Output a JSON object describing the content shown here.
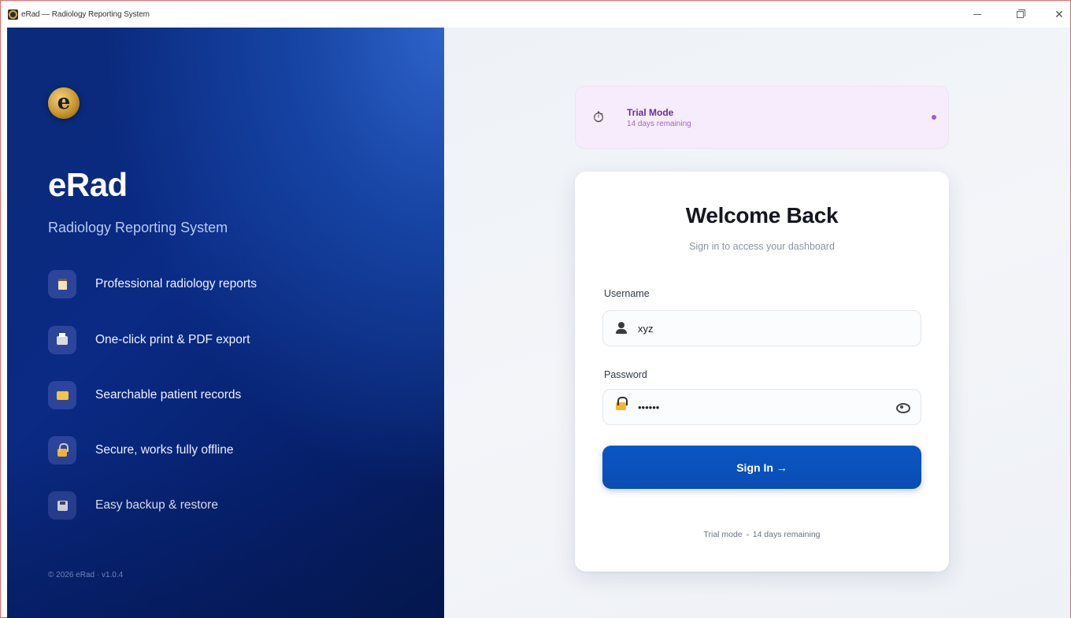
{
  "window": {
    "title": "eRad — Radiology Reporting System"
  },
  "brand": {
    "name": "eRad",
    "tagline": "Radiology Reporting System",
    "logo_icon": "erad-logo-icon"
  },
  "features": [
    {
      "icon": "clipboard-icon",
      "label": "Professional radiology reports"
    },
    {
      "icon": "printer-icon",
      "label": "One-click print & PDF export"
    },
    {
      "icon": "folder-icon",
      "label": "Searchable patient records"
    },
    {
      "icon": "lock-icon",
      "label": "Secure, works fully offline"
    },
    {
      "icon": "floppy-disk-icon",
      "label": "Easy backup & restore"
    }
  ],
  "footer": {
    "version_text": "© 2026 eRad · v1.0.4"
  },
  "trial_banner": {
    "title": "Trial Mode",
    "subtitle": "14 days remaining",
    "icon": "stopwatch-icon"
  },
  "login": {
    "heading": "Welcome Back",
    "subheading": "Sign in to access your dashboard",
    "username_label": "Username",
    "username_value": "xyz",
    "password_label": "Password",
    "password_value": "••••••",
    "submit_label": "Sign In →",
    "footer_mode": "Trial mode",
    "footer_days": "14 days remaining"
  },
  "colors": {
    "accent": "#0a50ba",
    "sidebar_bg": "#0a2a84",
    "trial_bg": "#f6ecfb",
    "trial_text": "#6b2f9a"
  }
}
